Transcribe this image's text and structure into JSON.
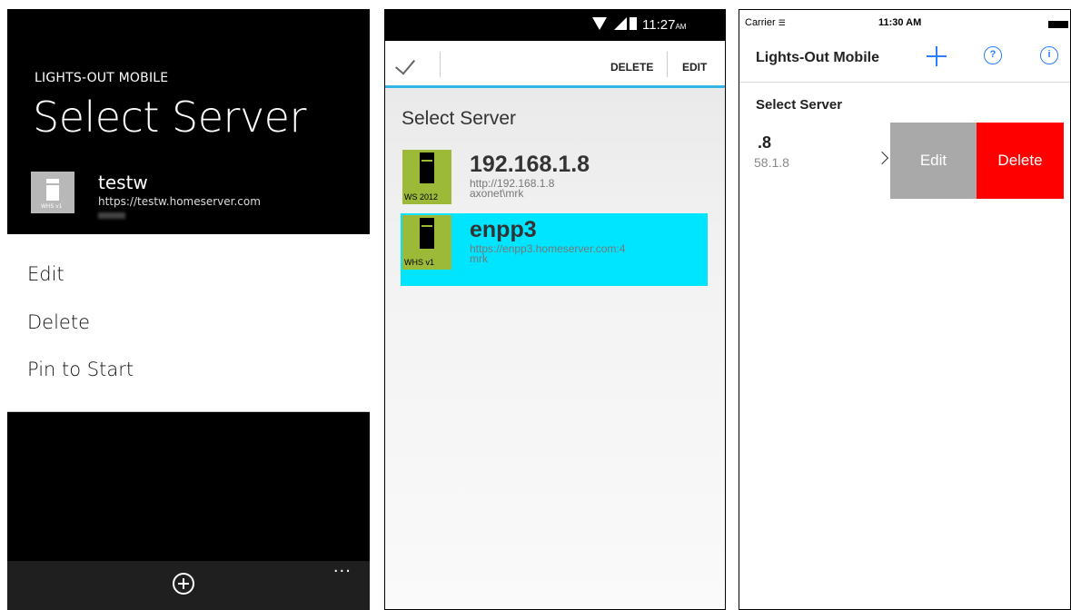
{
  "windows_phone": {
    "app_name": "LIGHTS-OUT MOBILE",
    "title": "Select Server",
    "server": {
      "name": "testw",
      "url": "https://testw.homeserver.com",
      "tile_label": "WHS v1"
    },
    "context_menu": [
      "Edit",
      "Delete",
      "Pin to Start"
    ],
    "appbar": {
      "more": "..."
    }
  },
  "android": {
    "status": {
      "time": "11:27",
      "ampm": "AM"
    },
    "actions": {
      "delete": "DELETE",
      "edit": "EDIT"
    },
    "heading": "Select Server",
    "servers": [
      {
        "name": "192.168.1.8",
        "url": "http://192.168.1.8",
        "user": "axonet\\mrk",
        "tag": "WS 2012",
        "selected": false
      },
      {
        "name": "enpp3",
        "url": "https://enpp3.homeserver.com:4",
        "user": "mrk",
        "tag": "WHS v1",
        "selected": true
      }
    ],
    "selected_color": "#00e5ff",
    "icon_color": "#9cba38"
  },
  "ios": {
    "status": {
      "carrier": "Carrier",
      "time": "11:30 AM"
    },
    "nav_title": "Lights-Out Mobile",
    "help_glyph": "?",
    "info_glyph": "i",
    "section": "Select Server",
    "cell": {
      "name": ".8",
      "subtitle": "58.1.8"
    },
    "swipe_actions": {
      "edit": "Edit",
      "delete": "Delete"
    },
    "accent": "#2a7fff",
    "delete_color": "#ff0000"
  }
}
